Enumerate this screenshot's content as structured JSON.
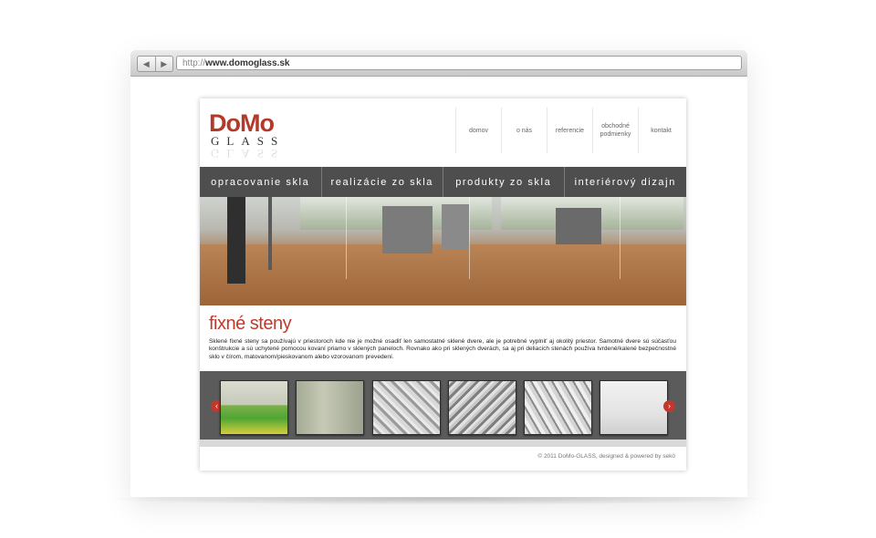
{
  "browser": {
    "url_protocol": "http://",
    "url_host": "www.domoglass.sk",
    "back_icon": "chevron-left-icon",
    "forward_icon": "chevron-right-icon"
  },
  "site": {
    "logo": {
      "top": "DoMo",
      "bottom": "GLASS"
    },
    "topnav": [
      {
        "label": "domov"
      },
      {
        "label": "o nás"
      },
      {
        "label": "referencie"
      },
      {
        "label": "obchodné podmienky"
      },
      {
        "label": "kontakt"
      }
    ],
    "mainmenu": [
      {
        "label": "opracovanie skla"
      },
      {
        "label": "realizácie zo skla"
      },
      {
        "label": "produkty zo skla"
      },
      {
        "label": "interiérový dizajn"
      }
    ],
    "content": {
      "title": "fixné steny",
      "body": "Sklené fixné steny sa používajú v priestoroch kde nie je možné osadiť len samostatné sklené dvere, ale je potrebné vyplniť aj okolitý priestor. Samotné dvere sú súčasťou konštrukcie a sú uchytené pomocou kovaní priamo v sklených paneloch. Rovnako ako pri sklených dverách, sa aj pri deliacich stenách používa tvrdené/kalené bezpečnostné sklo v čírom, matovanom/pieskovanom alebo vzorovanom prevedení."
    },
    "gallery": {
      "prev_icon": "arrow-left-icon",
      "next_icon": "arrow-right-icon",
      "prev_glyph": "‹",
      "next_glyph": "›"
    },
    "footer": "© 2011 DoMo-GLASS, designed & powered by sekö"
  },
  "colors": {
    "brand_red": "#c0392b",
    "menu_bg": "#4e4e4e",
    "gallery_bg": "#5b5b5b"
  }
}
